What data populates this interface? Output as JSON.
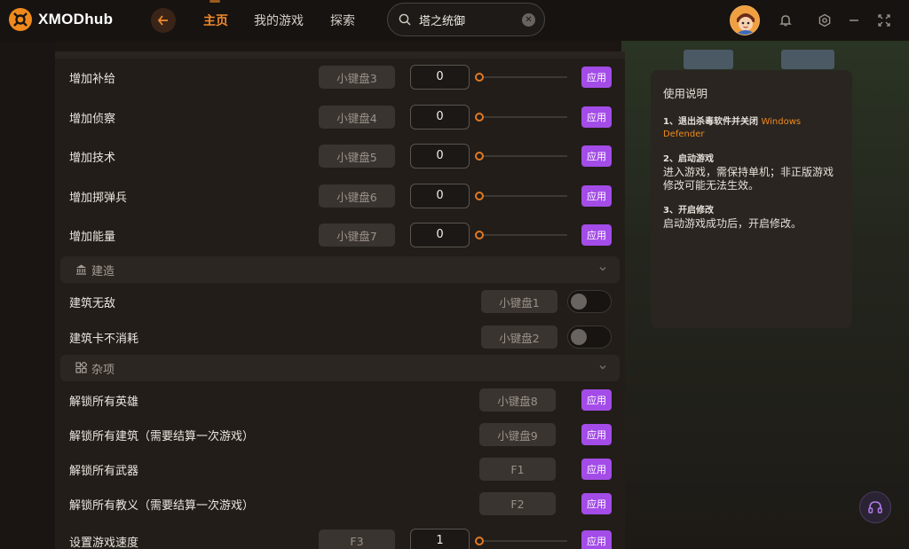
{
  "app": {
    "logo_text": "XMODhub",
    "accent_color": "#f28a2a",
    "apply_color": "#a34ce8"
  },
  "nav": {
    "home": "主页",
    "my_games": "我的游戏",
    "explore": "探索"
  },
  "search": {
    "value": "塔之统御"
  },
  "cheats": {
    "rows_top": [
      {
        "label": "增加补给",
        "hotkey": "小键盘3",
        "value": "0",
        "apply": "应用"
      },
      {
        "label": "增加侦察",
        "hotkey": "小键盘4",
        "value": "0",
        "apply": "应用"
      },
      {
        "label": "增加技术",
        "hotkey": "小键盘5",
        "value": "0",
        "apply": "应用"
      },
      {
        "label": "增加掷弹兵",
        "hotkey": "小键盘6",
        "value": "0",
        "apply": "应用"
      },
      {
        "label": "增加能量",
        "hotkey": "小键盘7",
        "value": "0",
        "apply": "应用"
      }
    ],
    "section_build": {
      "title": "建造",
      "rows": [
        {
          "label": "建筑无敌",
          "hotkey": "小键盘1",
          "enabled": false
        },
        {
          "label": "建筑卡不消耗",
          "hotkey": "小键盘2",
          "enabled": false
        }
      ]
    },
    "section_misc": {
      "title": "杂项",
      "rows": [
        {
          "label": "解锁所有英雄",
          "hotkey": "小键盘8",
          "apply": "应用"
        },
        {
          "label": "解锁所有建筑（需要结算一次游戏）",
          "hotkey": "小键盘9",
          "apply": "应用"
        },
        {
          "label": "解锁所有武器",
          "hotkey": "F1",
          "apply": "应用"
        },
        {
          "label": "解锁所有教义（需要结算一次游戏）",
          "hotkey": "F2",
          "apply": "应用"
        }
      ]
    },
    "speed_row": {
      "label": "设置游戏速度",
      "hotkey": "F3",
      "value": "1",
      "apply": "应用"
    }
  },
  "instructions": {
    "title": "使用说明",
    "step1_title": "1、退出杀毒软件并关闭",
    "step1_accent": "Windows Defender",
    "step2_title": "2、启动游戏",
    "step2_body": "进入游戏，需保持单机；非正版游戏修改可能无法生效。",
    "step3_title": "3、开启修改",
    "step3_body": "启动游戏成功后，开启修改。"
  },
  "icons": {
    "logo": "xmod-logo-icon",
    "back": "back-arrow-icon",
    "search": "search-icon",
    "clear": "clear-icon",
    "notification": "bell-icon",
    "settings": "settings-icon",
    "minimize": "minimize-icon",
    "fullscreen": "fullscreen-icon",
    "build": "building-icon",
    "misc": "grid-icon",
    "support": "headset-icon"
  }
}
